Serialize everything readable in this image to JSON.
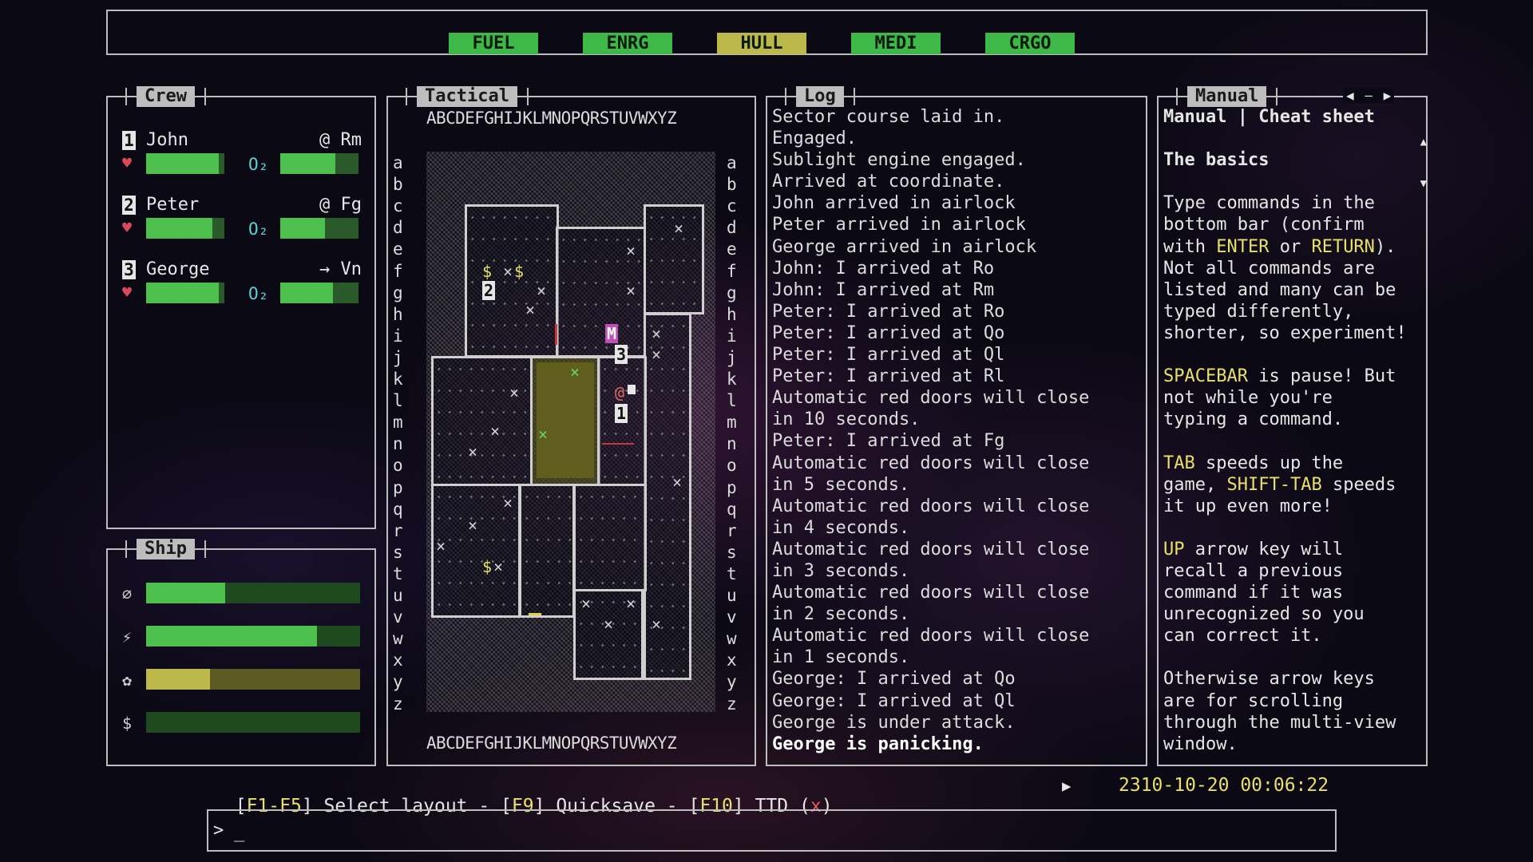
{
  "status_bar": {
    "buttons": [
      {
        "label": "FUEL",
        "color": "#3fb84a"
      },
      {
        "label": "ENRG",
        "color": "#3fb84a"
      },
      {
        "label": "HULL",
        "color": "#bdb84a"
      },
      {
        "label": "MEDI",
        "color": "#3fb84a"
      },
      {
        "label": "CRGO",
        "color": "#3fb84a"
      }
    ]
  },
  "crew_panel": {
    "title": "Crew",
    "members": [
      {
        "num": "1",
        "name": "John",
        "location": "@ Rm",
        "health": 0.93,
        "o2": 0.7
      },
      {
        "num": "2",
        "name": "Peter",
        "location": "@ Fg",
        "health": 0.85,
        "o2": 0.57
      },
      {
        "num": "3",
        "name": "George",
        "location": "→ Vn",
        "health": 0.93,
        "o2": 0.67
      }
    ],
    "o2_label": "O₂"
  },
  "ship_panel": {
    "title": "Ship",
    "rows": [
      {
        "icon": "⌀",
        "level": 0.37,
        "color": "#4cbf4c"
      },
      {
        "icon": "⚡",
        "level": 0.8,
        "color": "#4cbf4c"
      },
      {
        "icon": "✿",
        "level": 0.3,
        "color": "#bdb84a"
      },
      {
        "icon": "$",
        "level": 0.0,
        "color": "#4cbf4c"
      }
    ]
  },
  "tactical_panel": {
    "title": "Tactical",
    "columns": "ABCDEFGHIJKLMNOPQRSTUVWXYZ",
    "rows": [
      "a",
      "b",
      "c",
      "d",
      "e",
      "f",
      "g",
      "h",
      "i",
      "j",
      "k",
      "l",
      "m",
      "n",
      "o",
      "p",
      "q",
      "r",
      "s",
      "t",
      "u",
      "v",
      "w",
      "x",
      "y",
      "z"
    ]
  },
  "log_panel": {
    "title": "Log",
    "lines": [
      "Sector course laid in.",
      "Engaged.",
      "Sublight engine engaged.",
      "Arrived at coordinate.",
      "John arrived in airlock",
      "Peter arrived in airlock",
      "George arrived in airlock",
      "John: I arrived at Ro",
      "John: I arrived at Rm",
      "Peter: I arrived at Ro",
      "Peter: I arrived at Qo",
      "Peter: I arrived at Ql",
      "Peter: I arrived at Rl",
      "Automatic red doors will close",
      "in 10 seconds.",
      "Peter: I arrived at Fg",
      "Automatic red doors will close",
      "in 5 seconds.",
      "Automatic red doors will close",
      "in 4 seconds.",
      "Automatic red doors will close",
      "in 3 seconds.",
      "Automatic red doors will close",
      "in 2 seconds.",
      "Automatic red doors will close",
      "in 1 seconds.",
      "George: I arrived at Qo",
      "George: I arrived at Ql",
      "George is under attack.",
      "George is panicking."
    ]
  },
  "manual_panel": {
    "title": "Manual",
    "nav_left": "◀",
    "nav_sep": "—",
    "nav_right": "▶",
    "scroll_up": "▲",
    "scroll_down": "▼",
    "header": "Manual | Cheat sheet",
    "section": "The basics",
    "p1_a": "Type commands in the",
    "p1_b": "bottom bar (confirm",
    "p1_c1": "with ",
    "p1_c_enter": "ENTER",
    "p1_c2": " or ",
    "p1_c_return": "RETURN",
    "p1_c3": ").",
    "p1_d": "Not all commands are",
    "p1_e": "listed and many can be",
    "p1_f": "typed differently,",
    "p1_g": "shorter, so experiment!",
    "p2_key": "SPACEBAR",
    "p2_a": " is pause! But",
    "p2_b": "not while you're",
    "p2_c": "typing a command.",
    "p3_key": "TAB",
    "p3_a": " speeds up the",
    "p3_b1": "game, ",
    "p3_key2": "SHIFT-TAB",
    "p3_b2": " speeds",
    "p3_c": "it up even more!",
    "p4_key": "UP",
    "p4_a": " arrow key will",
    "p4_b": "recall a previous",
    "p4_c": "command if it was",
    "p4_d": "unrecognized so you",
    "p4_e": "can correct it.",
    "p5_a": "Otherwise arrow keys",
    "p5_b": "are for scrolling",
    "p5_c": "through the multi-view",
    "p5_d": "window."
  },
  "footer": {
    "open1": "[",
    "k1": "F1-F5",
    "t1": "] Select layout - [",
    "k2": "F9",
    "t2": "] Quicksave - [",
    "k3": "F10",
    "t3": "] TTD (",
    "x": "x",
    "t4": ")",
    "play": "▶",
    "datetime": "2310-10-20 00:06:22"
  },
  "command_bar": {
    "prompt": ">",
    "cursor": "_"
  }
}
